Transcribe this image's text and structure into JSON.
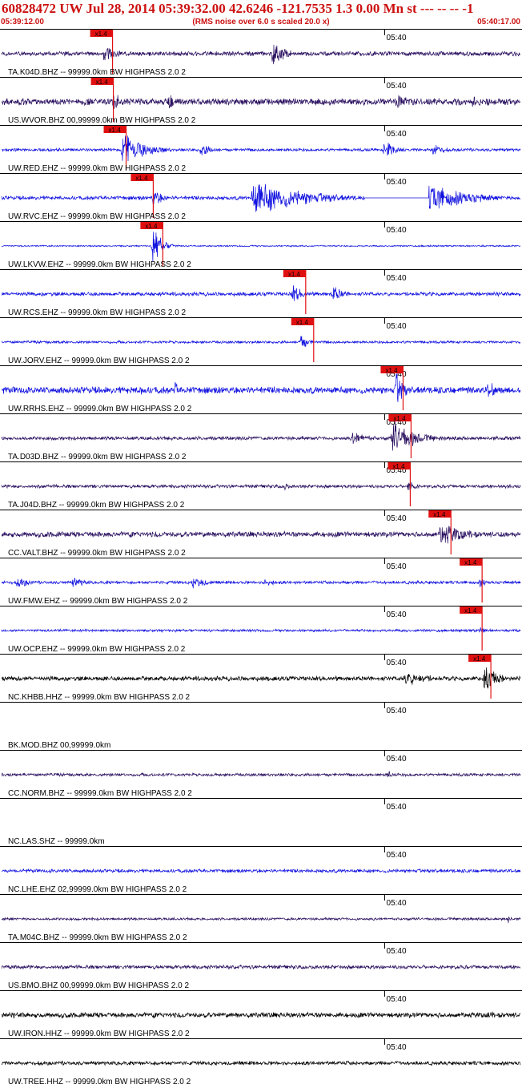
{
  "header": {
    "title": "60828472 UW Jul 28, 2014 05:39:32.00   42.6246 -121.7535  1.3 0.00 Mn st --- -- --  -1",
    "start_time": "05:39:12.00",
    "end_time": "05:40:17.00",
    "subtitle": "(RMS noise over 6.0 s scaled 20.0 x)"
  },
  "chart_data": {
    "type": "line",
    "x_start": "05:39:12.00",
    "x_end": "05:40:17.00",
    "minute_marker": "05:40",
    "traces": [
      {
        "label": "TA.K04D.BHZ -- 99999.0km BW  HIGHPASS  2.0  2",
        "color": "#2a1060",
        "pick": "x1.4",
        "pick_time_s": 13.9,
        "noise": 0.12,
        "events": [
          {
            "t": 12.9,
            "d": 3,
            "a": 0.6
          },
          {
            "t": 34.0,
            "d": 3,
            "a": 0.9
          }
        ],
        "gaps": []
      },
      {
        "label": "US.WVOR.BHZ 00,99999.0km BW  HIGHPASS  2.0  2",
        "color": "#2a1060",
        "pick": "x1.4",
        "pick_time_s": 14.0,
        "noise": 0.18,
        "events": [
          {
            "t": 14.0,
            "d": 4,
            "a": 0.5
          },
          {
            "t": 21.0,
            "d": 2,
            "a": 0.5
          },
          {
            "t": 49.5,
            "d": 4,
            "a": 0.5
          },
          {
            "t": 59.0,
            "d": 4,
            "a": 0.4
          }
        ],
        "gaps": []
      },
      {
        "label": "UW.RED.EHZ -- 99999.0km BW  HIGHPASS  2.0  2",
        "color": "#1010e0",
        "pick": "x1.4",
        "pick_time_s": 15.6,
        "noise": 0.08,
        "events": [
          {
            "t": 15.2,
            "d": 6,
            "a": 0.9
          },
          {
            "t": 25.0,
            "d": 3,
            "a": 0.4
          },
          {
            "t": 48.0,
            "d": 3,
            "a": 0.6
          },
          {
            "t": 54.0,
            "d": 3,
            "a": 0.4
          }
        ],
        "gaps": []
      },
      {
        "label": "UW.RVC.EHZ -- 99999.0km BW  HIGHPASS  2.0  2",
        "color": "#1010e0",
        "pick": "x1.4",
        "pick_time_s": 19.0,
        "noise": 0.1,
        "events": [
          {
            "t": 19.0,
            "d": 3,
            "a": 0.5
          },
          {
            "t": 31.5,
            "d": 13.5,
            "a": 1.0
          },
          {
            "t": 53.5,
            "d": 11,
            "a": 0.8
          }
        ],
        "gaps": [
          {
            "t0": 45.5,
            "t1": 53.5
          }
        ]
      },
      {
        "label": "UW.LKVW.EHZ -- 99999.0km BW  HIGHPASS  2.0  2",
        "color": "#1010e0",
        "pick": "x1.4",
        "pick_time_s": 20.2,
        "noise": 0.04,
        "events": [
          {
            "t": 19.0,
            "d": 2.5,
            "a": 1.0
          }
        ],
        "gaps": []
      },
      {
        "label": "UW.RCS.EHZ -- 99999.0km BW  HIGHPASS  2.0  2",
        "color": "#1010e0",
        "pick": "x1.4",
        "pick_time_s": 38.1,
        "noise": 0.1,
        "events": [
          {
            "t": 36.5,
            "d": 3,
            "a": 0.5
          },
          {
            "t": 41.5,
            "d": 3,
            "a": 0.5
          }
        ],
        "gaps": []
      },
      {
        "label": "UW.JORV.EHZ -- 99999.0km BW  HIGHPASS  2.0  2",
        "color": "#1010e0",
        "pick": "x1.4",
        "pick_time_s": 39.1,
        "noise": 0.07,
        "events": [
          {
            "t": 37.5,
            "d": 2,
            "a": 0.5
          }
        ],
        "gaps": []
      },
      {
        "label": "UW.RRHS.EHZ -- 99999.0km BW  HIGHPASS  2.0  2",
        "color": "#1010e0",
        "pick": "x1.4",
        "pick_time_s": 50.3,
        "noise": 0.18,
        "events": [
          {
            "t": 49.5,
            "d": 2,
            "a": 1.0
          },
          {
            "t": 17.5,
            "d": 0.6,
            "a": 0.6
          },
          {
            "t": 21.8,
            "d": 0.6,
            "a": 0.6
          },
          {
            "t": 61.0,
            "d": 3,
            "a": 0.5
          }
        ],
        "gaps": []
      },
      {
        "label": "TA.D03D.BHZ -- 99999.0km BW  HIGHPASS  2.0  2",
        "color": "#2a1060",
        "pick": "x1.4",
        "pick_time_s": 51.3,
        "noise": 0.1,
        "events": [
          {
            "t": 44.0,
            "d": 5,
            "a": 0.4
          },
          {
            "t": 49.0,
            "d": 6,
            "a": 1.0
          }
        ],
        "gaps": []
      },
      {
        "label": "TA.J04D.BHZ -- 99999.0km BW  HIGHPASS  2.0  2",
        "color": "#2a1060",
        "pick": "x1.4",
        "pick_time_s": 51.2,
        "noise": 0.09,
        "events": [
          {
            "t": 35.5,
            "d": 1,
            "a": 0.3
          },
          {
            "t": 51.0,
            "d": 2,
            "a": 0.4
          }
        ],
        "gaps": []
      },
      {
        "label": "CC.VALT.BHZ -- 99999.0km BW  HIGHPASS  2.0  2",
        "color": "#2a1060",
        "pick": "x1.4",
        "pick_time_s": 56.3,
        "noise": 0.15,
        "events": [
          {
            "t": 55.0,
            "d": 8,
            "a": 0.65
          }
        ],
        "gaps": []
      },
      {
        "label": "UW.FMW.EHZ -- 99999.0km BW  HIGHPASS  2.0  2",
        "color": "#1010e0",
        "pick": "x1.4",
        "pick_time_s": 60.2,
        "noise": 0.08,
        "events": [
          {
            "t": 2.0,
            "d": 4,
            "a": 0.3
          },
          {
            "t": 9.0,
            "d": 4,
            "a": 0.3
          },
          {
            "t": 24.0,
            "d": 4,
            "a": 0.35
          },
          {
            "t": 33.0,
            "d": 3,
            "a": 0.25
          },
          {
            "t": 60.0,
            "d": 1.5,
            "a": 0.3
          }
        ],
        "gaps": []
      },
      {
        "label": "UW.OCP.EHZ -- 99999.0km BW  HIGHPASS  2.0  2",
        "color": "#1010e0",
        "pick": "x1.4",
        "pick_time_s": 60.2,
        "noise": 0.07,
        "events": [
          {
            "t": 60.0,
            "d": 1.5,
            "a": 0.3
          }
        ],
        "gaps": []
      },
      {
        "label": "NC.KHBB.HHZ -- 99999.0km BW  HIGHPASS  2.0  2",
        "color": "#000000",
        "pick": "x1.4",
        "pick_time_s": 61.3,
        "noise": 0.12,
        "events": [
          {
            "t": 50.5,
            "d": 7,
            "a": 0.45
          },
          {
            "t": 60.5,
            "d": 3,
            "a": 1.0
          }
        ],
        "gaps": []
      },
      {
        "label": "BK.MOD.BHZ 00,99999.0km",
        "color": "#2a1060",
        "pick": "",
        "pick_time_s": null,
        "noise": 0,
        "events": [],
        "gaps": [],
        "flat": true
      },
      {
        "label": "CC.NORM.BHZ -- 99999.0km BW  HIGHPASS  2.0  2",
        "color": "#2a1060",
        "pick": "",
        "pick_time_s": null,
        "noise": 0.08,
        "events": [
          {
            "t": 48.5,
            "d": 1,
            "a": 0.3
          }
        ],
        "gaps": []
      },
      {
        "label": "NC.LAS.SHZ -- 99999.0km",
        "color": "#2a1060",
        "pick": "",
        "pick_time_s": null,
        "noise": 0,
        "events": [],
        "gaps": [],
        "flat": true
      },
      {
        "label": "NC.LHE.EHZ 02,99999.0km BW  HIGHPASS  2.0  2",
        "color": "#1010e0",
        "pick": "",
        "pick_time_s": null,
        "noise": 0.09,
        "events": [],
        "gaps": []
      },
      {
        "label": "TA.M04C.BHZ -- 99999.0km BW  HIGHPASS  2.0  2",
        "color": "#2a1060",
        "pick": "",
        "pick_time_s": null,
        "noise": 0.07,
        "events": [
          {
            "t": 63.5,
            "d": 0.8,
            "a": 0.3
          }
        ],
        "gaps": []
      },
      {
        "label": "US.BMO.BHZ 00,99999.0km BW  HIGHPASS  2.0  2",
        "color": "#2a1060",
        "pick": "",
        "pick_time_s": null,
        "noise": 0.1,
        "events": [],
        "gaps": []
      },
      {
        "label": "UW.IRON.HHZ -- 99999.0km BW  HIGHPASS  2.0  2",
        "color": "#000000",
        "pick": "",
        "pick_time_s": null,
        "noise": 0.14,
        "events": [
          {
            "t": 61.0,
            "d": 2,
            "a": 0.3
          }
        ],
        "gaps": []
      },
      {
        "label": "UW.TREE.HHZ -- 99999.0km BW  HIGHPASS  2.0  2",
        "color": "#000000",
        "pick": "",
        "pick_time_s": null,
        "noise": 0.1,
        "events": [],
        "gaps": []
      }
    ]
  }
}
